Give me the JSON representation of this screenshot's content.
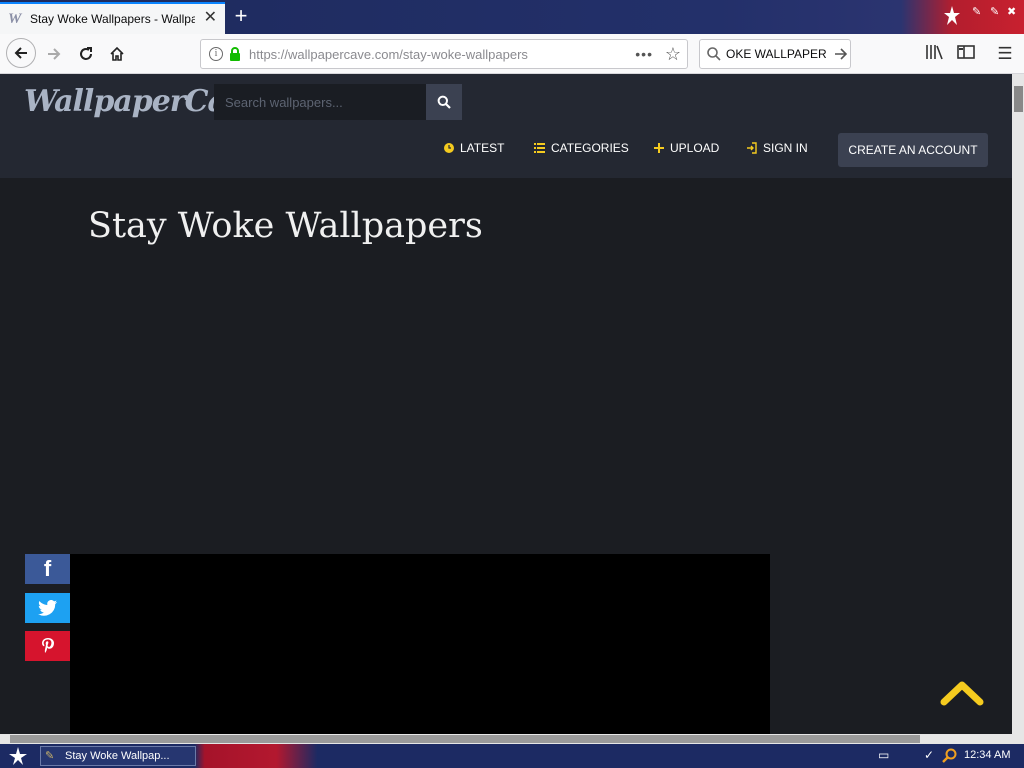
{
  "browser": {
    "tab_title": "Stay Woke Wallpapers - Wallpaper",
    "favicon": "W",
    "new_tab": "+",
    "url_host": "https://wallpapercave.com",
    "url_path": "/stay-woke-wallpapers",
    "search_value": "OKE WALLPAPER",
    "page_actions": "•••"
  },
  "site": {
    "logo": "WallpaperCave",
    "search_placeholder": "Search wallpapers...",
    "nav": {
      "latest": "LATEST",
      "categories": "CATEGORIES",
      "upload": "UPLOAD",
      "sign_in": "SIGN IN",
      "create_account": "CREATE AN ACCOUNT"
    },
    "accent": "#f5cb1f"
  },
  "page": {
    "title": "Stay Woke Wallpapers"
  },
  "share": {
    "facebook": "f",
    "facebook_color": "#3b5998",
    "twitter_color": "#1da1f2",
    "pinterest_color": "#d6142d"
  },
  "taskbar": {
    "task_label": "Stay Woke Wallpap...",
    "clock": "12:34 AM"
  }
}
